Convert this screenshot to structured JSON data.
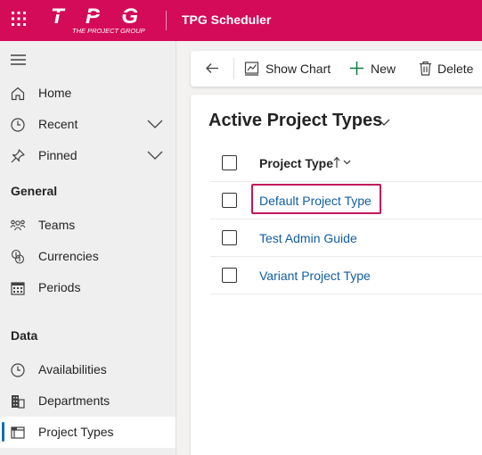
{
  "header": {
    "logo_text": "TPG",
    "logo_tagline": "THE PROJECT GROUP",
    "app_title": "TPG Scheduler",
    "brand_color": "#d30b59"
  },
  "sidebar": {
    "items": [
      {
        "label": "Home",
        "icon": "home-icon"
      },
      {
        "label": "Recent",
        "icon": "clock-icon",
        "expandable": true
      },
      {
        "label": "Pinned",
        "icon": "pin-icon",
        "expandable": true
      }
    ],
    "groups": [
      {
        "title": "General",
        "items": [
          {
            "label": "Teams",
            "icon": "people-icon"
          },
          {
            "label": "Currencies",
            "icon": "coins-icon"
          },
          {
            "label": "Periods",
            "icon": "calendar-icon"
          }
        ]
      },
      {
        "title": "Data",
        "items": [
          {
            "label": "Availabilities",
            "icon": "clock-icon"
          },
          {
            "label": "Departments",
            "icon": "building-icon"
          },
          {
            "label": "Project Types",
            "icon": "folder-icon",
            "selected": true
          }
        ]
      }
    ],
    "selected_color": "#0f6cbd"
  },
  "commandbar": {
    "back_icon": "back-arrow-icon",
    "show_chart": "Show Chart",
    "new": "New",
    "delete": "Delete"
  },
  "view": {
    "title": "Active Project Types",
    "column": "Project Type",
    "sort": "ascending",
    "rows": [
      {
        "name": "Default Project Type",
        "focused": true
      },
      {
        "name": "Test Admin Guide"
      },
      {
        "name": "Variant Project Type"
      }
    ],
    "link_color": "#115ea3"
  }
}
